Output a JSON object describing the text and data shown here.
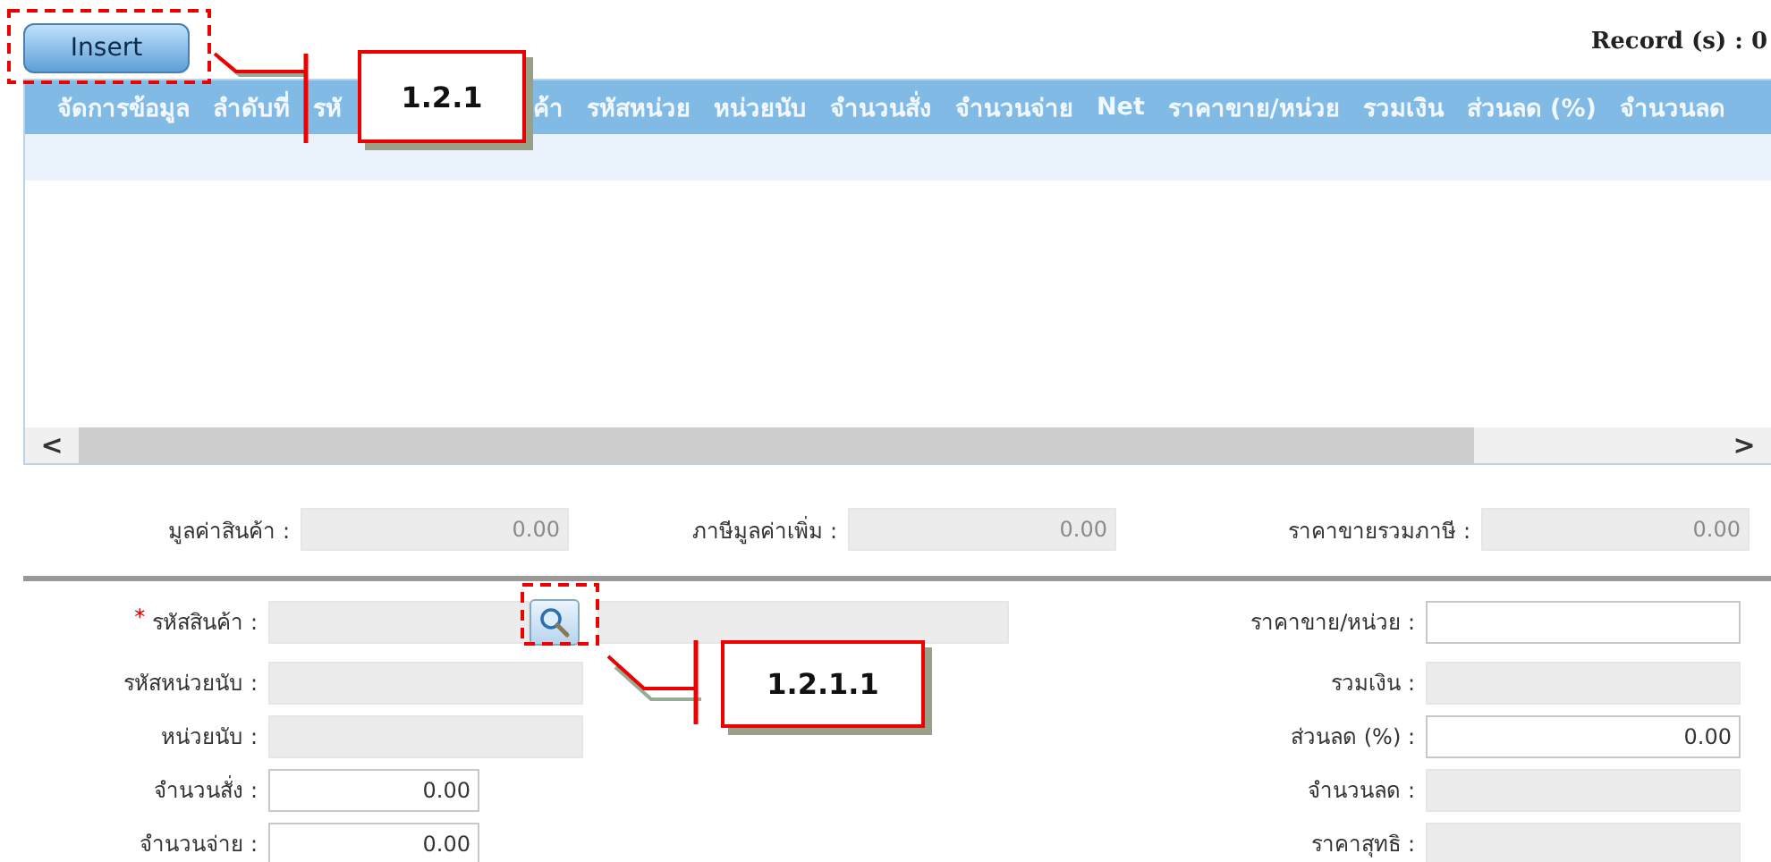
{
  "toolbar": {
    "insert_button": "Insert",
    "record_count": "Record (s) : 0"
  },
  "grid": {
    "columns": [
      "จัดการข้อมูล",
      "ลำดับที่",
      "รหั"
    ],
    "columns_right_of_callout": [
      "ค้า",
      "รหัสหน่วย",
      "หน่วยนับ",
      "จำนวนสั่ง",
      "จำนวนจ่าย",
      "Net",
      "ราคาขาย/หน่วย",
      "รวมเงิน",
      "ส่วนลด (%)",
      "จำนวนลด"
    ],
    "scroll_left": "<",
    "scroll_right": ">"
  },
  "totals": [
    {
      "label": "มูลค่าสินค้า :",
      "value": "0.00",
      "readonly": true
    },
    {
      "label": "ภาษีมูลค่าเพิ่ม :",
      "value": "0.00",
      "readonly": true
    },
    {
      "label": "ราคาขายรวมภาษี :",
      "value": "0.00",
      "readonly": true
    }
  ],
  "form_left": [
    {
      "label": "รหัสสินค้า :",
      "required": true,
      "readonly": true,
      "lookup": true
    },
    {
      "label": "รหัสหน่วยนับ :",
      "required": false,
      "readonly": true,
      "lookup": false
    },
    {
      "label": "หน่วยนับ :",
      "required": false,
      "readonly": true,
      "lookup": false
    },
    {
      "label": "จำนวนสั่ง :",
      "value": "0.00",
      "required": false,
      "readonly": false,
      "lookup": false
    },
    {
      "label": "จำนวนจ่าย :",
      "value": "0.00",
      "required": false,
      "readonly": false,
      "lookup": false
    }
  ],
  "required_mark": "*",
  "form_right": [
    {
      "label": "ราคาขาย/หน่วย :",
      "readonly": false
    },
    {
      "label": "รวมเงิน :",
      "readonly": true
    },
    {
      "label": "ส่วนลด (%) :",
      "value": "0.00",
      "readonly": false
    },
    {
      "label": "จำนวนลด :",
      "readonly": true
    },
    {
      "label": "ราคาสุทธิ :",
      "readonly": true
    }
  ],
  "callouts": [
    {
      "label": "1.2.1"
    },
    {
      "label": "1.2.1.1"
    }
  ]
}
